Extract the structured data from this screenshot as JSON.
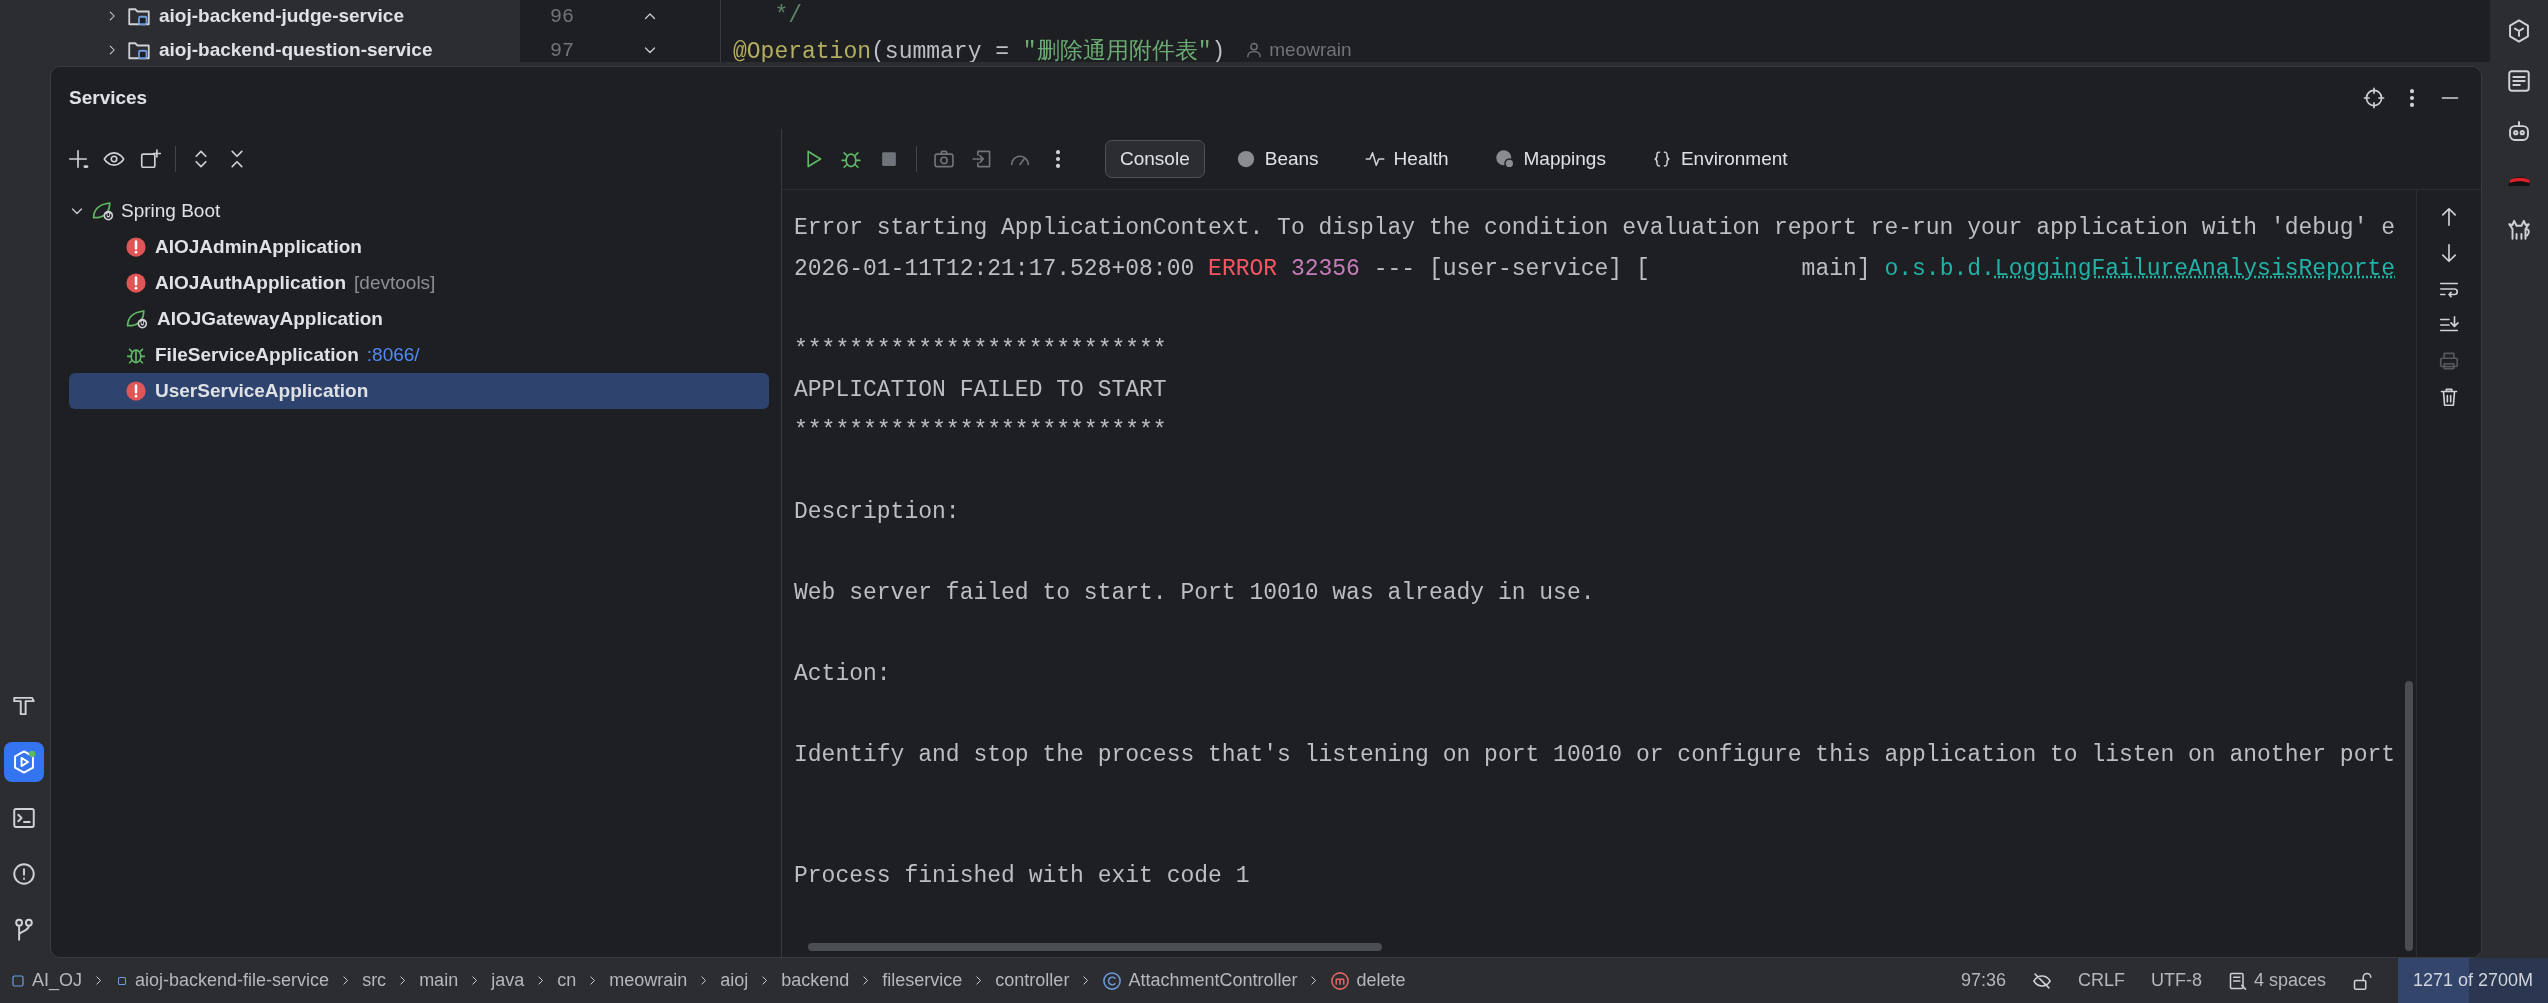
{
  "project_tree": {
    "items": [
      {
        "label": "aioj-backend-judge-service",
        "expanded": false
      },
      {
        "label": "aioj-backend-question-service",
        "expanded": false
      }
    ]
  },
  "editor": {
    "lines": [
      {
        "number": "96",
        "kind": "fold_up",
        "segments": [
          {
            "kind": "comment",
            "text": "   */"
          }
        ]
      },
      {
        "number": "97",
        "kind": "fold_down",
        "segments": [
          {
            "kind": "annotation",
            "text": "@Operation"
          },
          {
            "kind": "plain",
            "text": "(summary = "
          },
          {
            "kind": "string",
            "text": "\"删除通用附件表\""
          },
          {
            "kind": "plain",
            "text": ")"
          }
        ],
        "author": "meowrain"
      }
    ]
  },
  "tool_stripe": [
    {
      "kind": "build",
      "selected": false
    },
    {
      "kind": "services",
      "selected": true
    },
    {
      "kind": "terminal",
      "selected": false
    },
    {
      "kind": "problems",
      "selected": false
    },
    {
      "kind": "git",
      "selected": false
    }
  ],
  "services": {
    "title": "Services",
    "tree": {
      "label": "Spring Boot",
      "expanded": true,
      "children": [
        {
          "label": "AIOJAdminApplication",
          "kind": "error",
          "selected": false
        },
        {
          "label": "AIOJAuthApplication",
          "suffix": {
            "kind": "note",
            "text": "[devtools]"
          },
          "kind": "error",
          "selected": false
        },
        {
          "label": "AIOJGatewayApplication",
          "kind": "idle",
          "selected": false
        },
        {
          "label": "FileServiceApplication",
          "suffix": {
            "kind": "link",
            "text": ":8066/"
          },
          "kind": "debugging",
          "selected": false
        },
        {
          "label": "UserServiceApplication",
          "kind": "error",
          "selected": true
        }
      ]
    },
    "tabs": [
      {
        "label": "Console",
        "kind": "console",
        "selected": true
      },
      {
        "label": "Beans",
        "kind": "beans",
        "selected": false
      },
      {
        "label": "Health",
        "kind": "health",
        "selected": false
      },
      {
        "label": "Mappings",
        "kind": "mappings",
        "selected": false
      },
      {
        "label": "Environment",
        "kind": "environment",
        "selected": false
      }
    ],
    "console": {
      "lines": [
        {
          "kind": "text",
          "segments": [
            {
              "kind": "plain",
              "text": "Error starting ApplicationContext. To display the condition evaluation report re-run your application with 'debug' e"
            }
          ]
        },
        {
          "kind": "text",
          "segments": [
            {
              "kind": "plain",
              "text": "2026-01-11T12:21:17.528+08:00 "
            },
            {
              "kind": "error",
              "text": "ERROR"
            },
            {
              "kind": "pid",
              "text": " 32356"
            },
            {
              "kind": "plain",
              "text": " --- [user-service] [           main] "
            },
            {
              "kind": "logger",
              "text": "o.s.b.d."
            },
            {
              "kind": "link",
              "text": "LoggingFailureAnalysisReporte"
            }
          ]
        },
        {
          "kind": "blank"
        },
        {
          "kind": "text",
          "segments": [
            {
              "kind": "plain",
              "text": "***************************"
            }
          ]
        },
        {
          "kind": "text",
          "segments": [
            {
              "kind": "plain",
              "text": "APPLICATION FAILED TO START"
            }
          ]
        },
        {
          "kind": "text",
          "segments": [
            {
              "kind": "plain",
              "text": "***************************"
            }
          ]
        },
        {
          "kind": "blank"
        },
        {
          "kind": "text",
          "segments": [
            {
              "kind": "plain",
              "text": "Description:"
            }
          ]
        },
        {
          "kind": "blank"
        },
        {
          "kind": "text",
          "segments": [
            {
              "kind": "plain",
              "text": "Web server failed to start. Port 10010 was already in use."
            }
          ]
        },
        {
          "kind": "blank"
        },
        {
          "kind": "text",
          "segments": [
            {
              "kind": "plain",
              "text": "Action:"
            }
          ]
        },
        {
          "kind": "blank"
        },
        {
          "kind": "text",
          "segments": [
            {
              "kind": "plain",
              "text": "Identify and stop the process that's listening on port 10010 or configure this application to listen on another port"
            }
          ]
        },
        {
          "kind": "blank"
        },
        {
          "kind": "blank"
        },
        {
          "kind": "text",
          "segments": [
            {
              "kind": "plain",
              "text": "Process finished with exit code 1"
            }
          ]
        }
      ]
    }
  },
  "status_bar": {
    "breadcrumbs": [
      {
        "label": "AI_OJ",
        "kind": "project"
      },
      {
        "label": "aioj-backend-file-service",
        "kind": "module"
      },
      {
        "label": "src",
        "kind": "folder"
      },
      {
        "label": "main",
        "kind": "folder"
      },
      {
        "label": "java",
        "kind": "folder"
      },
      {
        "label": "cn",
        "kind": "folder"
      },
      {
        "label": "meowrain",
        "kind": "folder"
      },
      {
        "label": "aioj",
        "kind": "folder"
      },
      {
        "label": "backend",
        "kind": "folder"
      },
      {
        "label": "fileservice",
        "kind": "folder"
      },
      {
        "label": "controller",
        "kind": "folder"
      },
      {
        "label": "AttachmentController",
        "kind": "class"
      },
      {
        "label": "delete",
        "kind": "method"
      }
    ],
    "position": "97:36",
    "line_separator": "CRLF",
    "encoding": "UTF-8",
    "indent": "4 spaces",
    "memory": {
      "text": "1271 of 2700M",
      "level": 0.47
    }
  }
}
